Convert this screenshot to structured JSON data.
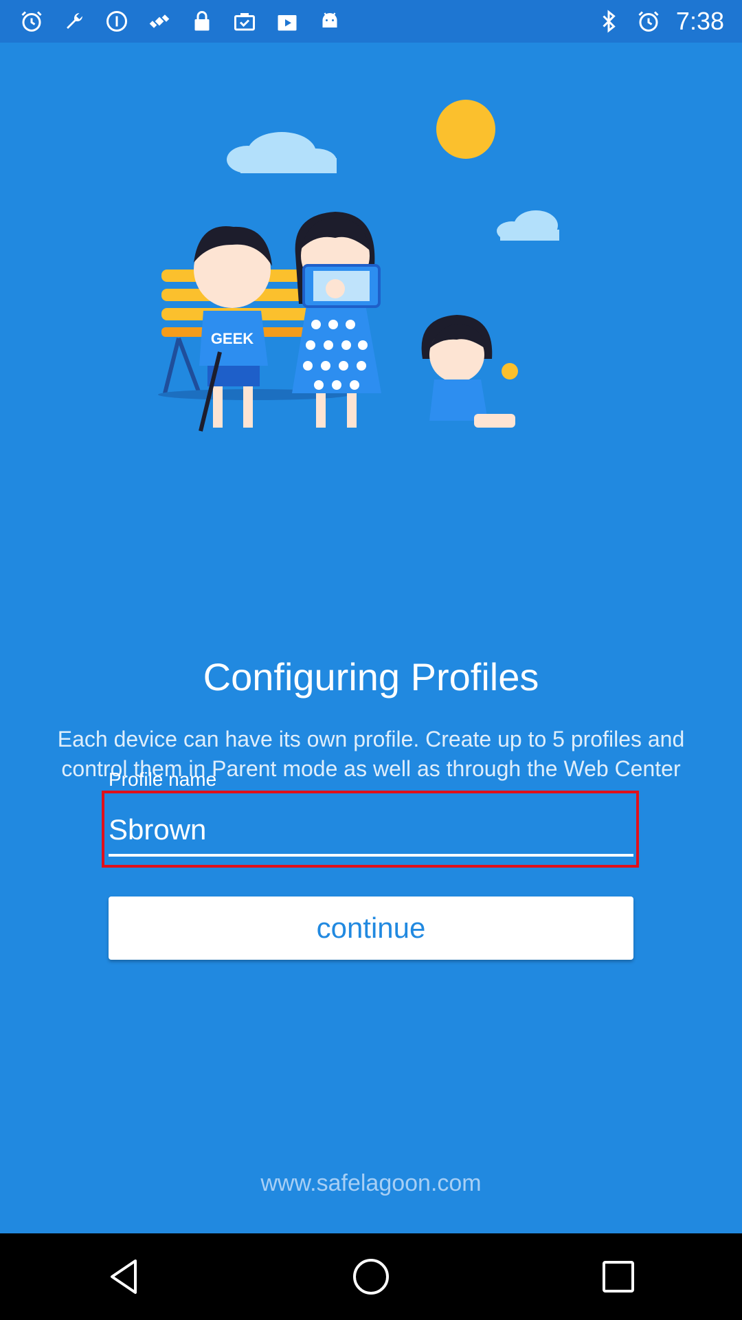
{
  "status_bar": {
    "time": "7:38",
    "left_icons": [
      "alarm-icon",
      "wrench-icon",
      "info-icon",
      "satellite-icon",
      "lock-icon",
      "briefcase-check-icon",
      "play-store-icon",
      "android-icon"
    ],
    "right_icons": [
      "bluetooth-icon",
      "alarm-icon"
    ]
  },
  "illustration": {
    "shirt_text": "GEEK"
  },
  "main": {
    "title": "Configuring Profiles",
    "description": "Each device can have its own profile. Create up to 5 profiles and control them in Parent mode as well as through the Web Center",
    "field_label": "Profile name",
    "field_value": "Sbrown",
    "continue_label": "continue",
    "footer_url": "www.safelagoon.com"
  },
  "colors": {
    "background": "#2189e0",
    "status_bar": "#1e76d2",
    "highlight": "#e0101a",
    "button_text": "#2189e0"
  },
  "nav_bar": {
    "icons": [
      "back-icon",
      "home-icon",
      "recents-icon"
    ]
  }
}
